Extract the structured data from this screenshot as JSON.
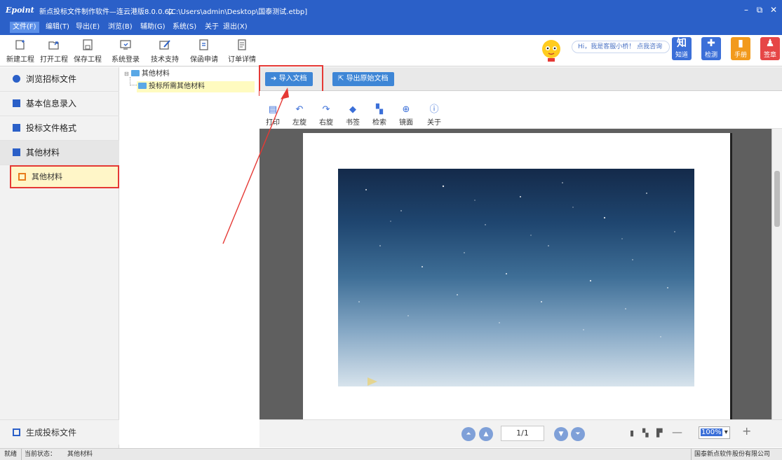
{
  "titlebar": {
    "logo": "Epoint",
    "title": "新点投标文件制作软件—连云港版8.0.0.62",
    "path": "[C:\\Users\\admin\\Desktop\\国泰测试.etbp]",
    "minimize": "–",
    "restore": "⧉",
    "close": "✕"
  },
  "menu": [
    "文件(F)",
    "编辑(T)",
    "导出(E)",
    "浏览(B)",
    "辅助(G)",
    "系统(S)",
    "关于",
    "退出(X)"
  ],
  "toolbar": {
    "items": [
      {
        "label": "新建工程",
        "icon": "new-project-icon"
      },
      {
        "label": "打开工程",
        "icon": "open-project-icon"
      },
      {
        "label": "保存工程",
        "icon": "save-icon"
      },
      {
        "label": "系统登录",
        "icon": "login-icon"
      },
      {
        "label": "技术支持",
        "icon": "support-icon"
      },
      {
        "label": "保函申请",
        "icon": "guarantee-icon"
      },
      {
        "label": "订单详情",
        "icon": "order-icon"
      }
    ],
    "assistant_hi": "Hi，我是客服小桥！",
    "assistant_ask": "点我咨询",
    "quick": [
      {
        "label": "知道",
        "glyph": "知",
        "color": "#3b6fd8"
      },
      {
        "label": "检测",
        "glyph": "✚",
        "color": "#3b6fd8"
      },
      {
        "label": "手册",
        "glyph": "▮",
        "color": "#f29a1c"
      },
      {
        "label": "签章",
        "glyph": "♟",
        "color": "#e64646"
      }
    ]
  },
  "leftnav": {
    "items": [
      "浏览招标文件",
      "基本信息录入",
      "投标文件格式",
      "其他材料"
    ],
    "sub_item": "其他材料",
    "generate": "生成投标文件"
  },
  "tree": {
    "root": "其他材料",
    "child": "投标所需其他材料"
  },
  "main": {
    "import_btn": "导入文档",
    "export_btn": "导出原始文档",
    "viewer_tools": [
      {
        "label": "打印",
        "glyph": "▤"
      },
      {
        "label": "左旋",
        "glyph": "↶"
      },
      {
        "label": "右旋",
        "glyph": "↷"
      },
      {
        "label": "书签",
        "glyph": "◆"
      },
      {
        "label": "检索",
        "glyph": "▚"
      },
      {
        "label": "镜面",
        "glyph": "⊕"
      },
      {
        "label": "关于",
        "glyph": "ⓘ"
      }
    ],
    "page_indicator": "1/1",
    "zoom": "100%"
  },
  "status": {
    "ready": "就绪",
    "state_label": "当前状态：",
    "state_value": "其他材料",
    "company": "国泰新点软件股份有限公司"
  },
  "colors": {
    "brand_blue": "#2b60c8",
    "highlight_red": "#e53935",
    "selected_yellow": "#fff6c8"
  }
}
